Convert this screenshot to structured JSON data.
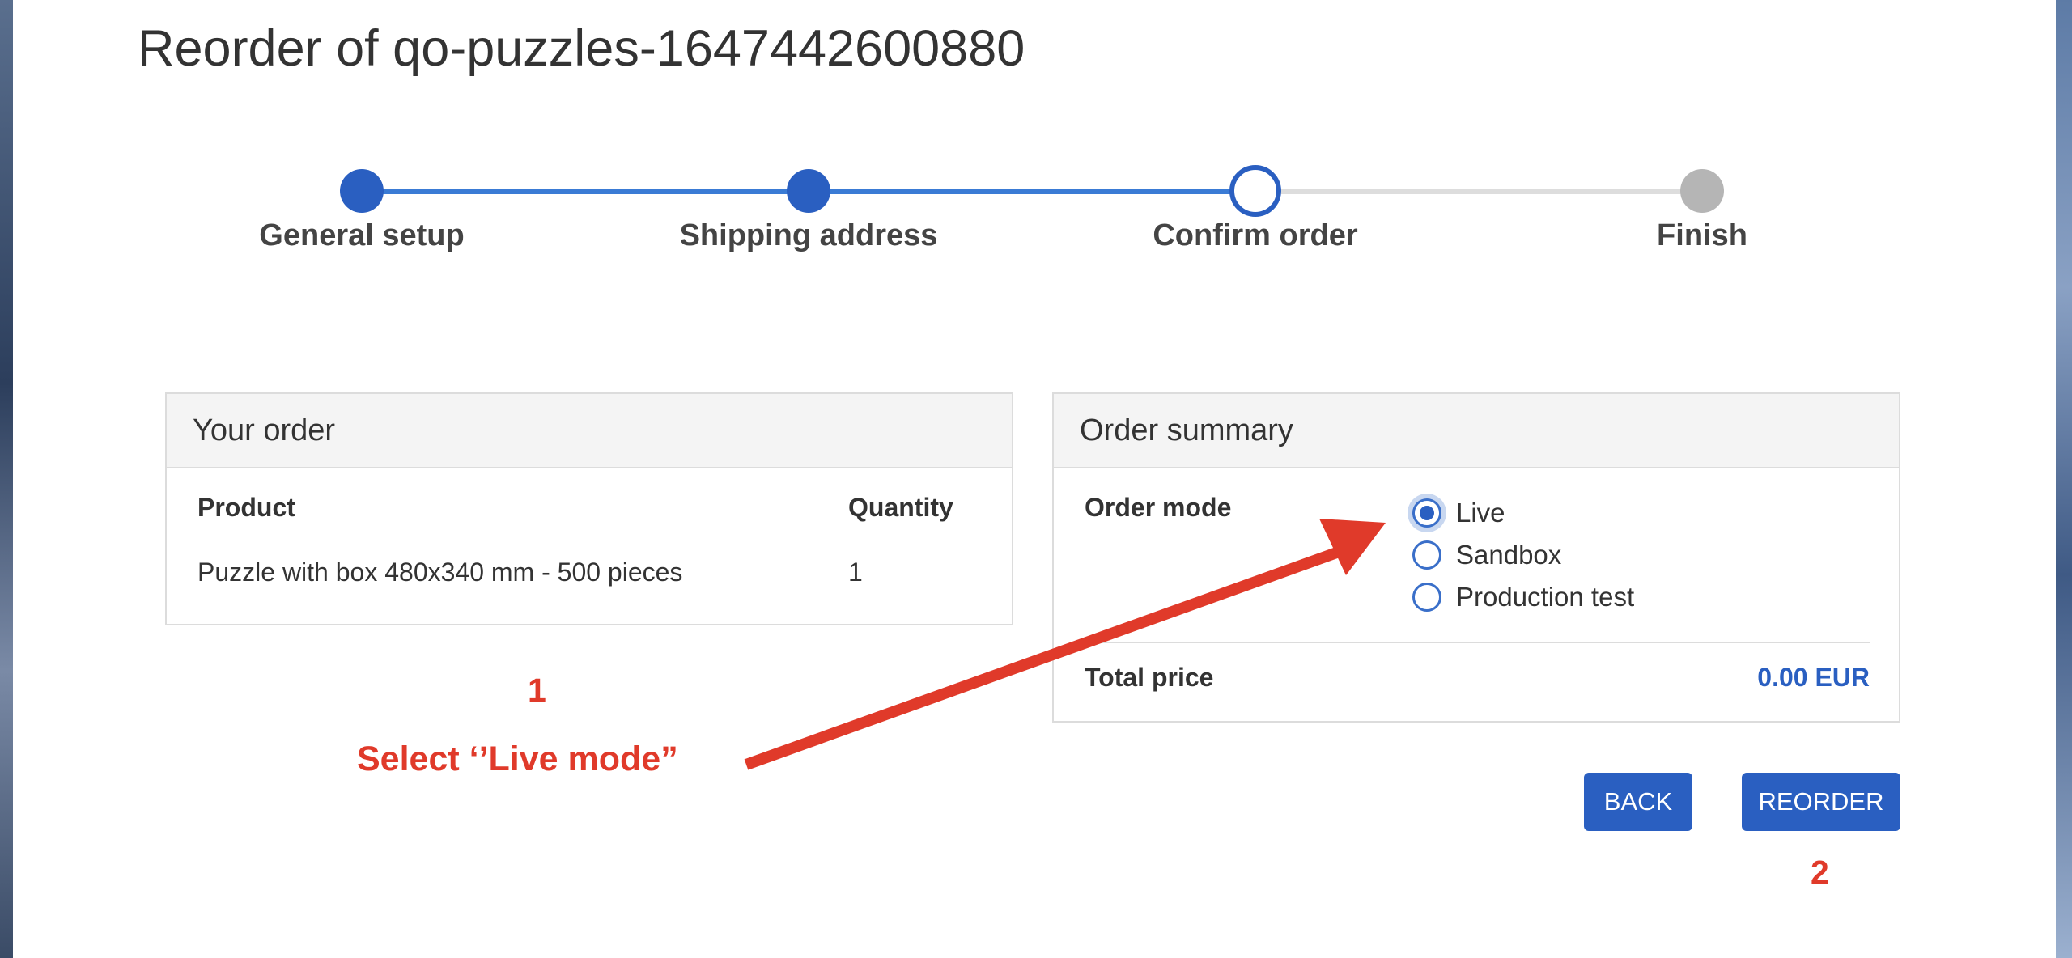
{
  "page": {
    "title": "Reorder of qo-puzzles-1647442600880"
  },
  "stepper": {
    "steps": [
      {
        "label": "General setup",
        "state": "done"
      },
      {
        "label": "Shipping address",
        "state": "done"
      },
      {
        "label": "Confirm order",
        "state": "current"
      },
      {
        "label": "Finish",
        "state": "todo"
      }
    ]
  },
  "your_order": {
    "title": "Your order",
    "columns": [
      "Product",
      "Quantity"
    ],
    "rows": [
      {
        "product": "Puzzle with box 480x340 mm - 500 pieces",
        "quantity": "1"
      }
    ]
  },
  "order_summary": {
    "title": "Order summary",
    "order_mode_label": "Order mode",
    "order_mode_options": [
      {
        "label": "Live",
        "checked": true
      },
      {
        "label": "Sandbox",
        "checked": false
      },
      {
        "label": "Production test",
        "checked": false
      }
    ],
    "total_price_label": "Total price",
    "total_price_value": "0.00 EUR"
  },
  "actions": {
    "back_label": "BACK",
    "reorder_label": "REORDER"
  },
  "annotations": {
    "step1_number": "1",
    "step1_text": "Select ‘’Live mode”",
    "step2_number": "2",
    "color": "#e03a2a"
  },
  "colors": {
    "primary": "#2a5fc1",
    "progress_line": "#3a7bd5",
    "inactive": "#b5b5b5"
  }
}
